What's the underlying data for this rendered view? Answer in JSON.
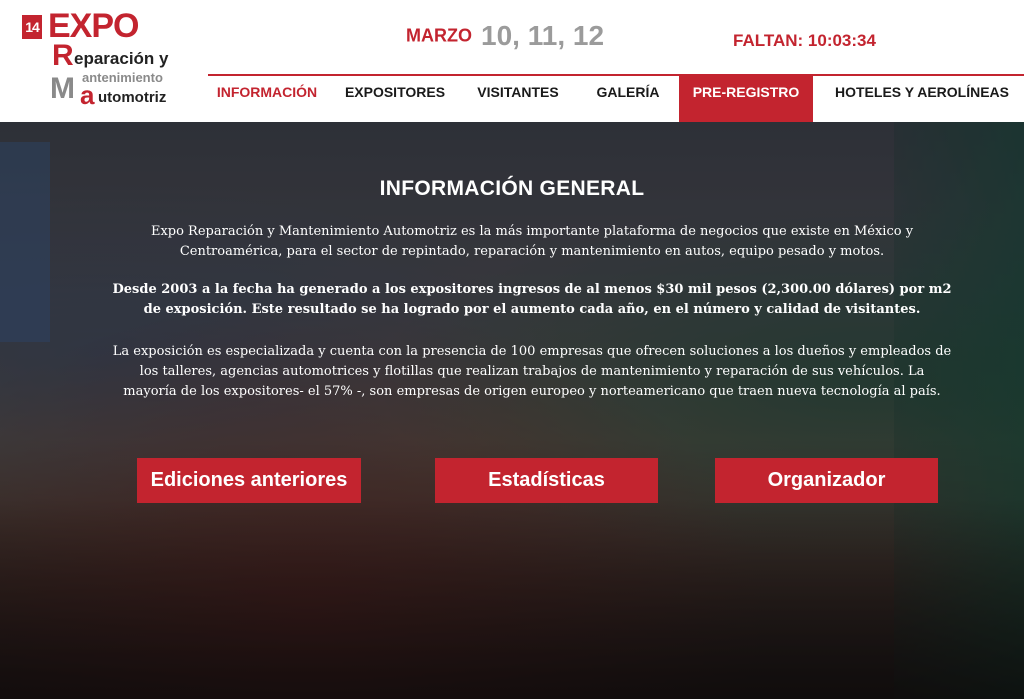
{
  "logo": {
    "badge": "14",
    "expo": "EXPO",
    "r": "R",
    "line1": "eparación y",
    "m": "M",
    "line2": "antenimiento",
    "a": "a",
    "line3": "utomotriz"
  },
  "event_date": {
    "label": "MARZO",
    "days": "10, 11, 12"
  },
  "countdown": "FALTAN: 10:03:34",
  "nav": [
    {
      "label": "INFORMACIÓN"
    },
    {
      "label": "EXPOSITORES"
    },
    {
      "label": "VISITANTES"
    },
    {
      "label": "GALERÍA"
    },
    {
      "label": "PRE-REGISTRO"
    },
    {
      "label": "HOTELES Y AEROLÍNEAS"
    }
  ],
  "main": {
    "title": "INFORMACIÓN GENERAL",
    "p1": "Expo Reparación y Mantenimiento Automotriz es la más importante plataforma de negocios que existe en México y Centroamérica, para el sector de repintado, reparación y mantenimiento en autos, equipo pesado y motos.",
    "p2": "Desde 2003 a la fecha ha generado a los expositores ingresos de al menos $30 mil pesos (2,300.00 dólares) por m2 de exposición. Este resultado se ha logrado por el aumento cada año, en el número y calidad de visitantes.",
    "p3": "La exposición es especializada y cuenta con la presencia de 100 empresas que ofrecen soluciones a los dueños y empleados de los talleres, agencias automotrices y flotillas que realizan trabajos de mantenimiento y reparación de sus vehículos. La mayoría de los expositores- el 57% -, son empresas de origen europeo y norteamericano que traen nueva tecnología al país."
  },
  "buttons": {
    "previous_editions": "Ediciones anteriores",
    "statistics": "Estadísticas",
    "organizer": "Organizador"
  },
  "colors": {
    "brand_red": "#c3242f",
    "gray": "#9b9b9b"
  }
}
